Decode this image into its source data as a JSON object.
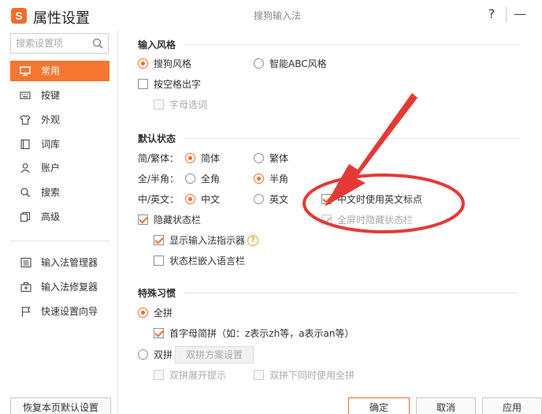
{
  "window": {
    "title": "属性设置",
    "subtitle": "搜狗输入法",
    "logo_letter": "S",
    "help_label": "?",
    "minimize_label": "—"
  },
  "sidebar": {
    "search_placeholder": "搜索设置项",
    "items": [
      {
        "label": "常用",
        "icon": "monitor-icon",
        "active": true
      },
      {
        "label": "按键",
        "icon": "keyboard-icon",
        "active": false
      },
      {
        "label": "外观",
        "icon": "tshirt-icon",
        "active": false
      },
      {
        "label": "词库",
        "icon": "book-icon",
        "active": false
      },
      {
        "label": "账户",
        "icon": "user-icon",
        "active": false
      },
      {
        "label": "搜索",
        "icon": "search-icon",
        "active": false
      },
      {
        "label": "高级",
        "icon": "layers-icon",
        "active": false
      }
    ],
    "tools": [
      {
        "label": "输入法管理器",
        "icon": "list-icon"
      },
      {
        "label": "输入法修复器",
        "icon": "toolbox-icon"
      },
      {
        "label": "快速设置向导",
        "icon": "flag-icon"
      }
    ]
  },
  "input_style": {
    "title": "输入风格",
    "sogou": "搜狗风格",
    "abc": "智能ABC风格",
    "space_output": "按空格出字",
    "letter_select": "字母选词"
  },
  "default_state": {
    "title": "默认状态",
    "simp_trad_label": "简/繁体：",
    "simplified": "简体",
    "traditional": "繁体",
    "width_label": "全/半角：",
    "full_width": "全角",
    "half_width": "半角",
    "lang_label": "中/英文：",
    "chinese": "中文",
    "english": "英文",
    "cn_en_punct": "中文时使用英文标点",
    "hide_status_bar": "隐藏状态栏",
    "fullscreen_hide": "全屏时隐藏状态栏",
    "show_indicator": "显示输入法指示器",
    "embed_langbar": "状态栏嵌入语言栏"
  },
  "special_habit": {
    "title": "特殊习惯",
    "quanpin": "全拼",
    "initial_abbrev": "首字母简拼（如：z表示zh等，a表示an等）",
    "shuangpin": "双拼",
    "shuangpin_scheme": "双拼方案设置",
    "shuangpin_expand": "双拼展开提示",
    "shuangpin_with_quanpin": "双拼下同时使用全拼"
  },
  "footer": {
    "restore": "恢复本页默认设置",
    "ok": "确定",
    "cancel": "取消",
    "apply": "应用"
  },
  "colors": {
    "accent": "#f26d2b",
    "annotation": "#e53935"
  }
}
